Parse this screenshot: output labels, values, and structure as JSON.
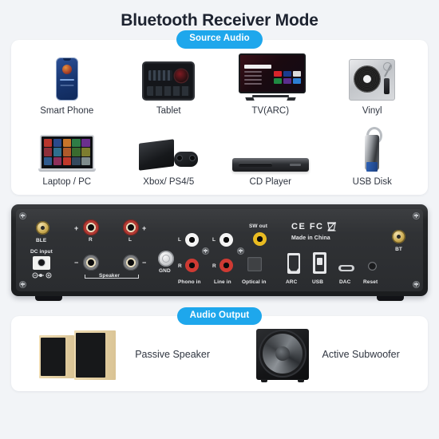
{
  "header": {
    "title": "Bluetooth Receiver Mode"
  },
  "source_section": {
    "badge": "Source Audio",
    "items": [
      {
        "label": "Smart Phone",
        "icon": "smartphone-icon"
      },
      {
        "label": "Tablet",
        "icon": "tablet-icon"
      },
      {
        "label": "TV(ARC)",
        "icon": "television-icon"
      },
      {
        "label": "Vinyl",
        "icon": "turntable-icon"
      },
      {
        "label": "Laptop / PC",
        "icon": "laptop-icon"
      },
      {
        "label": "Xbox/ PS4/5",
        "icon": "game-console-icon"
      },
      {
        "label": "CD Player",
        "icon": "cd-player-icon"
      },
      {
        "label": "USB Disk",
        "icon": "usb-flash-drive-icon"
      }
    ]
  },
  "device": {
    "name": "amplifier-rear-panel",
    "labels": {
      "ble": "BLE",
      "dc_input": "DC input",
      "speaker": "Speaker",
      "speaker_r": "R",
      "speaker_l": "L",
      "plus_left": "+",
      "plus_right": "+",
      "minus_left": "−",
      "minus_right": "−",
      "gnd": "GND",
      "phono_in": "Phono in",
      "line_in": "Line in",
      "optical_in": "Optical in",
      "sw_out": "SW out",
      "phono_l": "L",
      "phono_r": "R",
      "line_l": "L",
      "line_r": "R",
      "arc": "ARC",
      "usb": "USB",
      "dac": "DAC",
      "reset": "Reset",
      "bt": "BT",
      "certifications": "CE FC",
      "origin": "Made in China"
    }
  },
  "output_section": {
    "badge": "Audio Output",
    "items": [
      {
        "label": "Passive Speaker",
        "icon": "bookshelf-speakers-icon"
      },
      {
        "label": "Active Subwoofer",
        "icon": "subwoofer-icon"
      }
    ]
  },
  "colors": {
    "background": "#f2f4f7",
    "badge": "#1ea7ec",
    "title": "#1d2330",
    "panel": "#2a2c2f"
  }
}
